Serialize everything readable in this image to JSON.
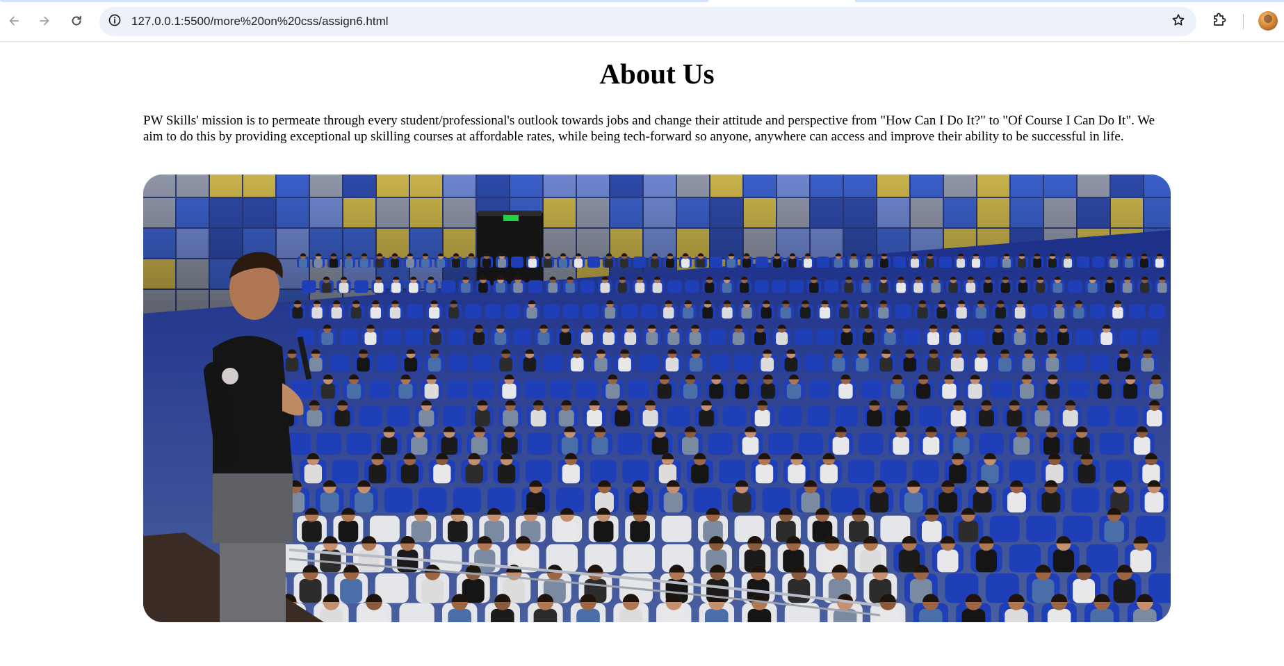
{
  "browser": {
    "url": "127.0.0.1:5500/more%20on%20css/assign6.html",
    "icons": {
      "back": "arrow-left-icon",
      "forward": "arrow-right-icon",
      "reload": "reload-icon",
      "site_info": "info-circle-icon",
      "bookmark": "star-icon",
      "extensions": "puzzle-icon",
      "profile": "avatar"
    }
  },
  "page": {
    "title": "About Us",
    "mission": "PW Skills' mission is to permeate through every student/professional's outlook towards jobs and change their attitude and perspective from \"How Can I Do It?\" to \"Of Course I Can Do It\". We aim to do this by providing exceptional up skilling courses at affordable rates, while being tech-forward so anyone, anywhere can access and improve their ability to be successful in life."
  },
  "colors": {
    "omnibox_bg": "#edf2fa",
    "seat_blue": "#1f3fb8",
    "wall_panels": [
      "#3a5fc8",
      "#c9b24a",
      "#8f96a8",
      "#2d49a8",
      "#6e86cf"
    ]
  }
}
